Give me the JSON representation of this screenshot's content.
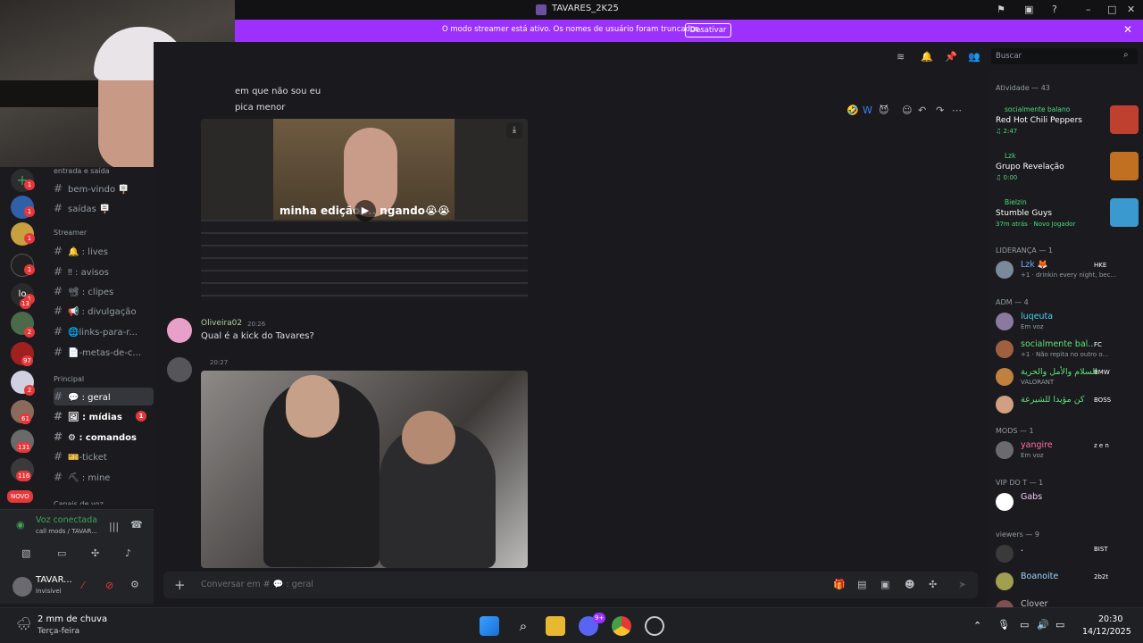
{
  "window": {
    "title": "TAVARES_2K25"
  },
  "banner": {
    "message": "O modo streamer está ativo. Os nomes de usuário foram truncados.",
    "button": "Desativar"
  },
  "channels": {
    "items": [
      {
        "label": "entrada e saída",
        "type": "category"
      },
      {
        "label": "bem-vindo 🪧",
        "type": "channel"
      },
      {
        "label": "saídas 🪧",
        "type": "channel"
      },
      {
        "label": "Streamer",
        "type": "category"
      },
      {
        "label": "🔔 : lives",
        "type": "channel"
      },
      {
        "label": "‼ : avisos",
        "type": "channel"
      },
      {
        "label": "📽 : clipes",
        "type": "channel"
      },
      {
        "label": "📢 : divulgação",
        "type": "channel"
      },
      {
        "label": "🌐links-para-r...",
        "type": "channel"
      },
      {
        "label": "📄-metas-de-c...",
        "type": "channel"
      },
      {
        "label": "Principal",
        "type": "category"
      },
      {
        "label": "💬 : geral",
        "type": "channel",
        "active": true
      },
      {
        "label": "🖼 : mídias",
        "type": "channel",
        "unread": true,
        "badge": "1"
      },
      {
        "label": "⚙ : comandos",
        "type": "channel",
        "unread": true
      },
      {
        "label": "🎫-ticket",
        "type": "channel"
      },
      {
        "label": "⛏ : mine",
        "type": "channel"
      },
      {
        "label": "Canais de voz",
        "type": "category"
      }
    ]
  },
  "rail": {
    "badges": [
      "1",
      "1",
      "1",
      "1",
      "1",
      "13",
      "2",
      "97",
      "2",
      "61",
      "131",
      "116"
    ],
    "new_label": "NOVO",
    "lo_label": "lo"
  },
  "voice": {
    "status": "Voz conectada",
    "channel": "call mods / TAVAR..."
  },
  "user": {
    "name": "TAVAR...",
    "status": "Invisível"
  },
  "messages": [
    {
      "text": "em que não sou eu"
    },
    {
      "text": "pica menor"
    },
    {
      "caption": "minha edição ... ngando😭😭"
    },
    {
      "author": "Oliveira02",
      "time": "20:26",
      "text": "Qual é a kick do Tavares?"
    },
    {
      "time": "20:27"
    }
  ],
  "composer": {
    "placeholder": "Conversar em # 💬 : geral"
  },
  "search": {
    "placeholder": "Buscar"
  },
  "members": {
    "activity_header": "Atividade — 43",
    "activities": [
      {
        "user": "socialmente balano",
        "title": "Red Hot Chili Peppers",
        "time": "♫ 2:47"
      },
      {
        "user": "Lzk",
        "title": "Grupo Revelação",
        "time": "♫ 0:00"
      },
      {
        "user": "Bielzin",
        "title": "Stumble Guys",
        "time": "37m atrás · Novo Jogador"
      }
    ],
    "groups": [
      {
        "label": "LIDERANÇA — 1",
        "members": [
          {
            "name": "Lzk 🦊",
            "tag": "HKE",
            "status": "+1 · drinkin every night, bec..."
          }
        ]
      },
      {
        "label": "ADM — 4",
        "members": [
          {
            "name": "luqeuta",
            "status": "Em voz"
          },
          {
            "name": "socialmente bal...",
            "tag": "FC",
            "status": "+1 · Não repita no outro o..."
          },
          {
            "name": "السلام والأمل والحرية",
            "tag": "BMW",
            "status": "VALORANT"
          },
          {
            "name": "كن مؤيدا للشيرعة",
            "tag": "BOSS",
            "status": ""
          }
        ]
      },
      {
        "label": "MODS — 1",
        "members": [
          {
            "name": "yangire",
            "tag": "z e n",
            "status": "Em voz"
          }
        ]
      },
      {
        "label": "VIP DO T — 1",
        "members": [
          {
            "name": "Gabs",
            "status": ""
          }
        ]
      },
      {
        "label": "viewers — 9",
        "members": [
          {
            "name": ".",
            "tag": "BIST",
            "status": ""
          },
          {
            "name": "Boanoite",
            "tag": "2b2t",
            "status": ""
          },
          {
            "name": "Clover",
            "status": ""
          }
        ]
      }
    ]
  },
  "taskbar": {
    "weather": "2 mm de chuva",
    "weekday": "Terça-feira",
    "time": "20:30",
    "date": "14/12/2025",
    "discord_badge": "9+"
  },
  "colors": {
    "banner": "#9b30ff",
    "voice_green": "#43a25a",
    "unread_badge": "#e5383b"
  }
}
